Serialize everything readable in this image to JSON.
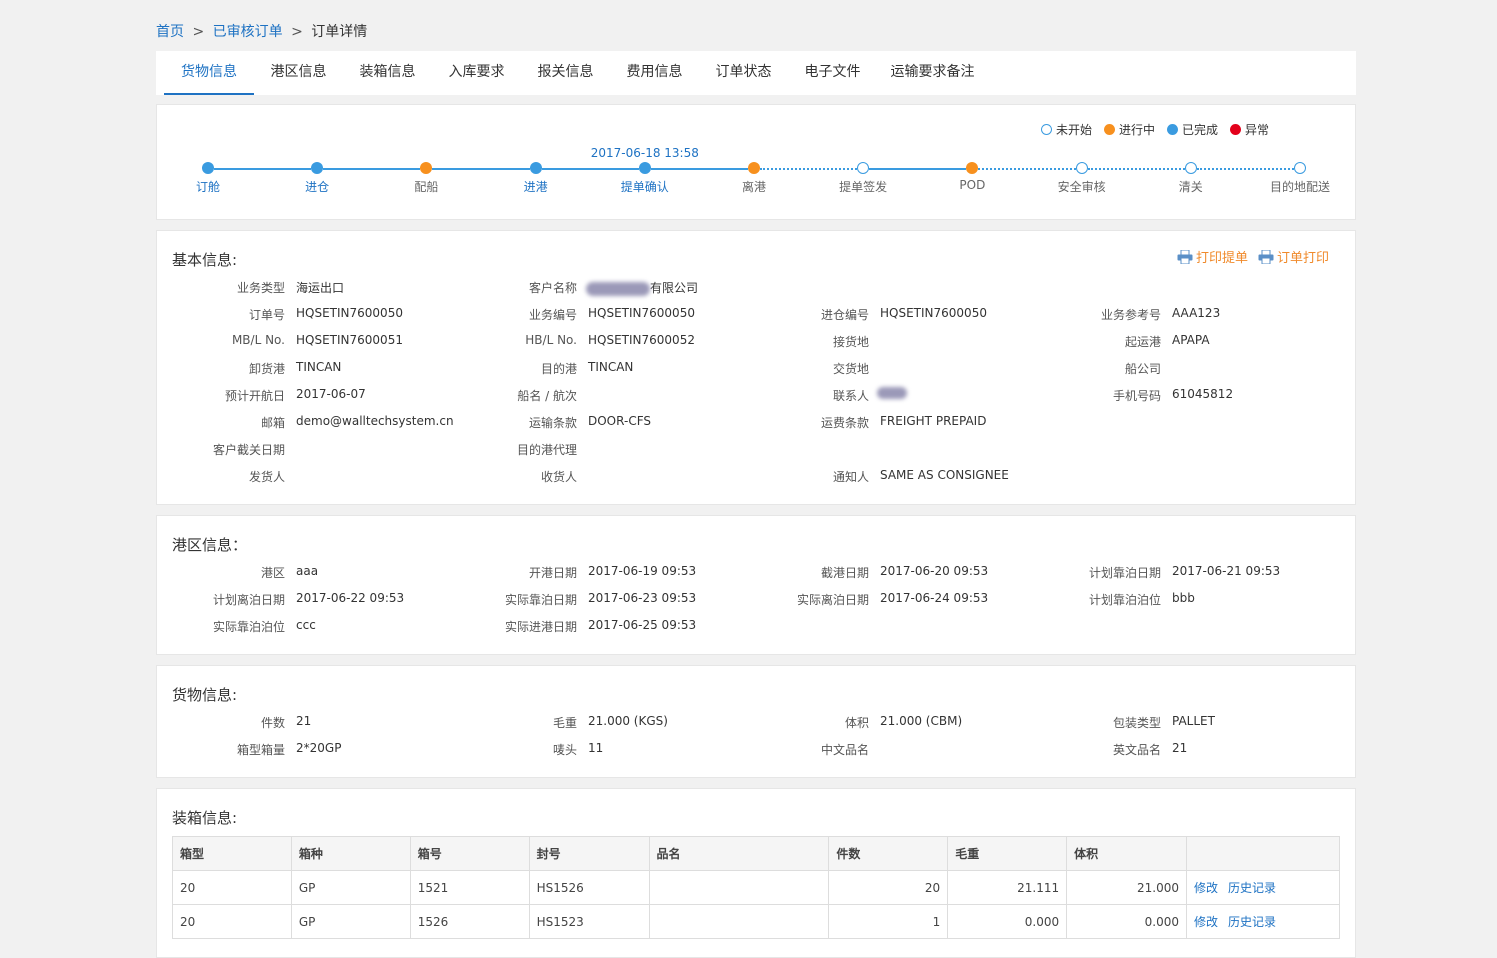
{
  "breadcrumb": {
    "home": "首页",
    "sep": ">",
    "parent": "已审核订单",
    "current": "订单详情"
  },
  "tabs": [
    {
      "label": "货物信息",
      "active": true
    },
    {
      "label": "港区信息"
    },
    {
      "label": "装箱信息"
    },
    {
      "label": "入库要求"
    },
    {
      "label": "报关信息"
    },
    {
      "label": "费用信息"
    },
    {
      "label": "订单状态"
    },
    {
      "label": "电子文件"
    },
    {
      "label": "运输要求备注"
    }
  ],
  "legend": [
    {
      "label": "未开始",
      "color": "#ffffff",
      "border": "#3a9be0"
    },
    {
      "label": "进行中",
      "color": "#f7901e",
      "border": "#f7901e"
    },
    {
      "label": "已完成",
      "color": "#3a9be0",
      "border": "#3a9be0"
    },
    {
      "label": "异常",
      "color": "#e3001b",
      "border": "#e3001b"
    }
  ],
  "colors": {
    "accent": "#1e72c3",
    "done": "#3a9be0",
    "progress": "#f7901e",
    "error": "#e3001b",
    "print": "#f08a2b"
  },
  "progress": {
    "time_label": "2017-06-18 13:58",
    "steps": [
      {
        "label": "订舱",
        "status": "done"
      },
      {
        "label": "进仓",
        "status": "done"
      },
      {
        "label": "配船",
        "status": "progress"
      },
      {
        "label": "进港",
        "status": "done"
      },
      {
        "label": "提单确认",
        "status": "done"
      },
      {
        "label": "离港",
        "status": "progress"
      },
      {
        "label": "提单签发",
        "status": "pending"
      },
      {
        "label": "POD",
        "status": "progress"
      },
      {
        "label": "安全审核",
        "status": "pending"
      },
      {
        "label": "清关",
        "status": "pending"
      },
      {
        "label": "目的地配送",
        "status": "pending"
      }
    ]
  },
  "basic": {
    "title": "基本信息:",
    "print_bl": "打印提单",
    "print_order": "订单打印",
    "fields": [
      {
        "label": "业务类型",
        "value": "海运出口"
      },
      {
        "label": "客户名称",
        "value": "有限公司",
        "blurred_prefix": true
      },
      {
        "label": "订单号",
        "value": "HQSETIN7600050"
      },
      {
        "label": "业务编号",
        "value": "HQSETIN7600050"
      },
      {
        "label": "进仓编号",
        "value": "HQSETIN7600050"
      },
      {
        "label": "业务参考号",
        "value": "AAA123"
      },
      {
        "label": "MB/L No.",
        "value": "HQSETIN7600051"
      },
      {
        "label": "HB/L No.",
        "value": "HQSETIN7600052"
      },
      {
        "label": "接货地",
        "value": ""
      },
      {
        "label": "起运港",
        "value": "APAPA"
      },
      {
        "label": "卸货港",
        "value": "TINCAN"
      },
      {
        "label": "目的港",
        "value": "TINCAN"
      },
      {
        "label": "交货地",
        "value": ""
      },
      {
        "label": "船公司",
        "value": ""
      },
      {
        "label": "预计开航日",
        "value": "2017-06-07"
      },
      {
        "label": "船名 / 航次",
        "value": ""
      },
      {
        "label": "联系人",
        "value": "",
        "blurred": true
      },
      {
        "label": "手机号码",
        "value": "61045812"
      },
      {
        "label": "邮箱",
        "value": "demo@walltechsystem.cn"
      },
      {
        "label": "运输条款",
        "value": "DOOR-CFS"
      },
      {
        "label": "运费条款",
        "value": "FREIGHT PREPAID"
      },
      {
        "label": "客户截关日期",
        "value": ""
      },
      {
        "label": "目的港代理",
        "value": ""
      },
      {
        "label": "发货人",
        "value": ""
      },
      {
        "label": "收货人",
        "value": ""
      },
      {
        "label": "通知人",
        "value": "SAME AS CONSIGNEE"
      }
    ]
  },
  "port": {
    "title": "港区信息：",
    "fields": [
      {
        "label": "港区",
        "value": "aaa"
      },
      {
        "label": "开港日期",
        "value": "2017-06-19 09:53"
      },
      {
        "label": "截港日期",
        "value": "2017-06-20 09:53"
      },
      {
        "label": "计划靠泊日期",
        "value": "2017-06-21 09:53"
      },
      {
        "label": "计划离泊日期",
        "value": "2017-06-22 09:53"
      },
      {
        "label": "实际靠泊日期",
        "value": "2017-06-23 09:53"
      },
      {
        "label": "实际离泊日期",
        "value": "2017-06-24 09:53"
      },
      {
        "label": "计划靠泊泊位",
        "value": "bbb"
      },
      {
        "label": "实际靠泊泊位",
        "value": "ccc"
      },
      {
        "label": "实际进港日期",
        "value": "2017-06-25 09:53"
      }
    ]
  },
  "cargo": {
    "title": "货物信息:",
    "fields": [
      {
        "label": "件数",
        "value": "21"
      },
      {
        "label": "毛重",
        "value": "21.000 (KGS)"
      },
      {
        "label": "体积",
        "value": "21.000 (CBM)"
      },
      {
        "label": "包装类型",
        "value": "PALLET"
      },
      {
        "label": "箱型箱量",
        "value": "2*20GP"
      },
      {
        "label": "唛头",
        "value": "11"
      },
      {
        "label": "中文品名",
        "value": ""
      },
      {
        "label": "英文品名",
        "value": "21"
      }
    ]
  },
  "container": {
    "title": "装箱信息:",
    "headers": [
      "箱型",
      "箱种",
      "箱号",
      "封号",
      "品名",
      "件数",
      "毛重",
      "体积",
      ""
    ],
    "edit_label": "修改",
    "history_label": "历史记录",
    "rows": [
      [
        "20",
        "GP",
        "1521",
        "HS1526",
        "",
        "20",
        "21.111",
        "21.000"
      ],
      [
        "20",
        "GP",
        "1526",
        "HS1523",
        "",
        "1",
        "0.000",
        "0.000"
      ]
    ]
  }
}
